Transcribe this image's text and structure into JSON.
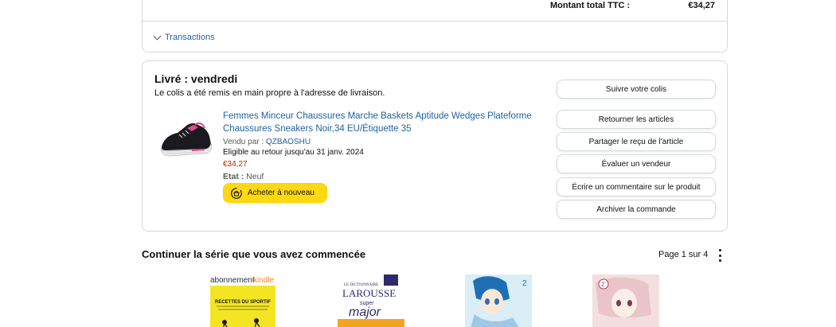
{
  "summary": {
    "total_label": "Montant total TTC :",
    "total_value": "€34,27",
    "transactions_label": "Transactions"
  },
  "order": {
    "status_title": "Livré : vendredi",
    "status_sub": "Le colis a été remis en main propre à l'adresse de livraison.",
    "product": {
      "title": "Femmes Minceur Chaussures Marche Baskets Aptitude Wedges Plateforme Chaussures Sneakers Noir,34 EU/Étiquette 35",
      "sold_by_label": "Vendu par : ",
      "seller": "QZBAOSHU",
      "return_eligibility": "Eligible au retour jusqu'au 31 janv. 2024",
      "price": "€34,27",
      "condition_label": "Etat :",
      "condition_value": " Neuf",
      "rebuy_label": "Acheter à nouveau"
    },
    "actions": [
      "Suivre votre colis",
      "Retourner les articles",
      "Partager le reçu de l'article",
      "Évaluer un vendeur",
      "Écrire un commentaire sur le produit",
      "Archiver la commande"
    ]
  },
  "series": {
    "title": "Continuer la série que vous avez commencée",
    "page_info": "Page 1 sur 4",
    "books": [
      {
        "header": "abonnement",
        "header_brand": "kindle",
        "cover_text": "RECETTES DU SPORTIF"
      },
      {
        "top_label": "LE DICTIONNAIRE",
        "brand": "LAROUSSE",
        "sub1": "super",
        "sub2": "major"
      },
      {
        "label": "2"
      },
      {
        "label": "2"
      }
    ]
  },
  "colors": {
    "link": "#2162a1",
    "price": "#b12704",
    "rebuy_button": "#ffd814",
    "border": "#d5d9d9"
  }
}
